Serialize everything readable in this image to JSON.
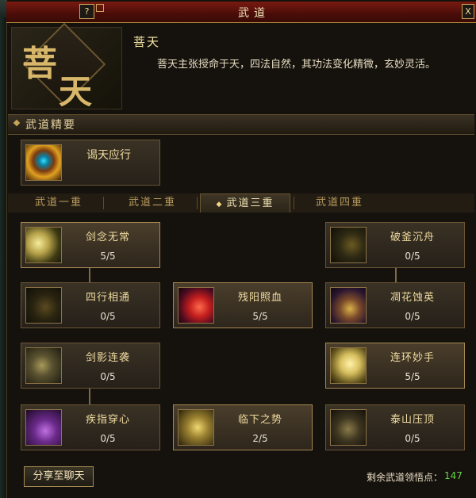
{
  "window": {
    "title": "武道",
    "help_label": "?",
    "close_label": "X"
  },
  "header": {
    "emblem_chars": [
      "菩",
      "天"
    ],
    "skill_name": "菩天",
    "description": "菩天主张授命于天，四法自然，其功法变化精微，玄妙灵活。"
  },
  "essentials": {
    "section_title": "武道精要",
    "card_label": "谒天应行"
  },
  "tabs": [
    {
      "label": "武道一重",
      "active": false
    },
    {
      "label": "武道二重",
      "active": false
    },
    {
      "label": "武道三重",
      "active": true
    },
    {
      "label": "武道四重",
      "active": false
    }
  ],
  "skills": [
    {
      "name": "剑念无常",
      "level": "5/5"
    },
    {
      "name": "破釜沉舟",
      "level": "0/5"
    },
    {
      "name": "四行相通",
      "level": "0/5"
    },
    {
      "name": "残阳照血",
      "level": "5/5"
    },
    {
      "name": "凋花蚀英",
      "level": "0/5"
    },
    {
      "name": "剑影连袭",
      "level": "0/5"
    },
    {
      "name": "连环妙手",
      "level": "5/5"
    },
    {
      "name": "疾指穿心",
      "level": "0/5"
    },
    {
      "name": "临下之势",
      "level": "2/5"
    },
    {
      "name": "泰山压顶",
      "level": "0/5"
    }
  ],
  "footer": {
    "share_label": "分享至聊天",
    "points_label": "剩余武道领悟点：",
    "points_value": "147"
  }
}
